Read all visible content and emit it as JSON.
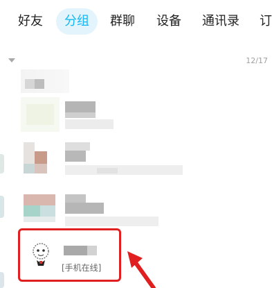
{
  "tabs": [
    {
      "label": "好友",
      "active": false
    },
    {
      "label": "分组",
      "active": true
    },
    {
      "label": "群聊",
      "active": false
    },
    {
      "label": "设备",
      "active": false
    },
    {
      "label": "通讯录",
      "active": false
    },
    {
      "label": "订",
      "active": false
    }
  ],
  "group": {
    "count": "12/17",
    "collapse_icon": "triangle-down-icon"
  },
  "last_friend": {
    "status": "[手机在线]",
    "avatar_icon": "cartoon-avatar-icon"
  },
  "annotation": {
    "highlight_color": "#e02020",
    "arrow_icon": "red-arrow-icon"
  },
  "colors": {
    "accent": "#12b7f5",
    "accent_bg": "#e3f4fd"
  }
}
